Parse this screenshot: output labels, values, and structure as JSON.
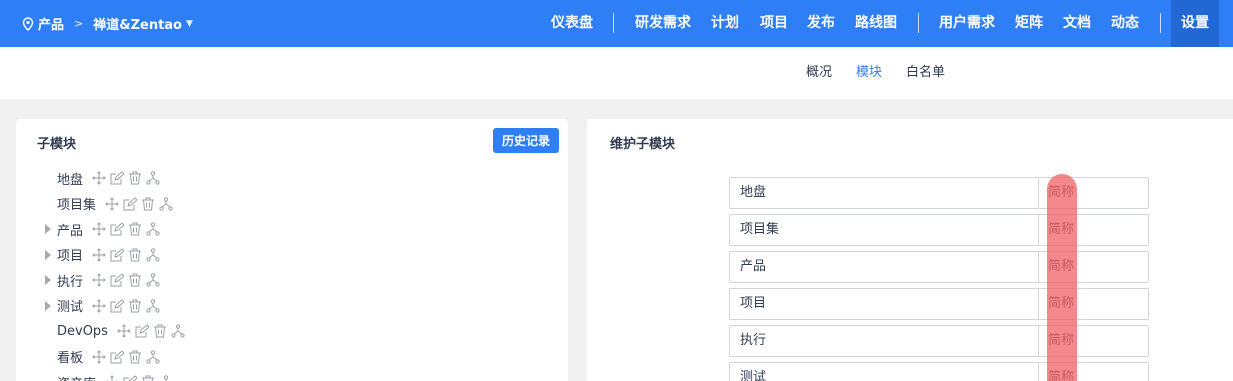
{
  "header": {
    "breadcrumb": {
      "section": "产品",
      "separator": ">",
      "product": "禅道&Zentao"
    },
    "nav_left": [
      "仪表盘"
    ],
    "nav_group1": [
      "研发需求",
      "计划",
      "项目",
      "发布",
      "路线图"
    ],
    "nav_group2": [
      "用户需求",
      "矩阵",
      "文档",
      "动态"
    ],
    "nav_active": "设置"
  },
  "subnav": {
    "tabs": [
      "概况",
      "模块",
      "白名单"
    ],
    "active": "模块"
  },
  "left_panel": {
    "title": "子模块",
    "history_button": "历史记录",
    "tree": [
      {
        "label": "地盘",
        "expandable": false
      },
      {
        "label": "项目集",
        "expandable": false
      },
      {
        "label": "产品",
        "expandable": true
      },
      {
        "label": "项目",
        "expandable": true
      },
      {
        "label": "执行",
        "expandable": true
      },
      {
        "label": "测试",
        "expandable": true
      },
      {
        "label": "DevOps",
        "expandable": false
      },
      {
        "label": "看板",
        "expandable": false
      },
      {
        "label": "资产库",
        "expandable": false
      }
    ],
    "row_actions": [
      "move-icon",
      "edit-icon",
      "delete-icon",
      "submodule-icon"
    ]
  },
  "right_panel": {
    "title": "维护子模块",
    "short_placeholder": "简称",
    "rows": [
      "地盘",
      "项目集",
      "产品",
      "项目",
      "执行",
      "测试"
    ]
  },
  "colors": {
    "primary": "#2e7ff5",
    "active_nav": "#2268d5",
    "highlight": "#f05a5f"
  }
}
